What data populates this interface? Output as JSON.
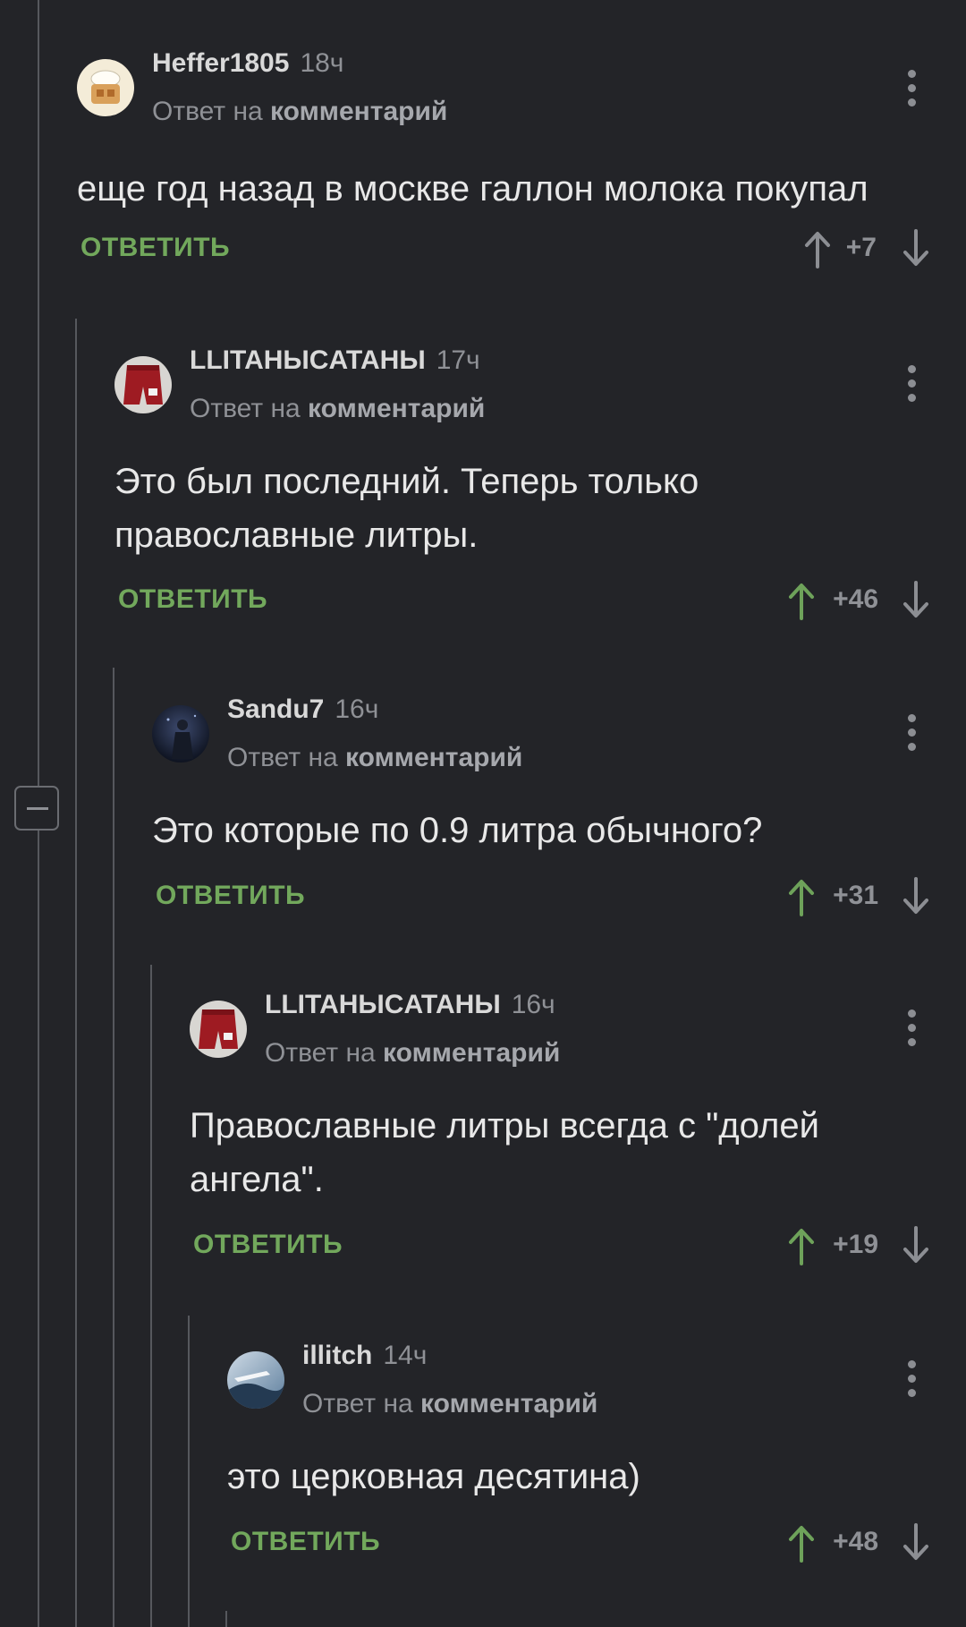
{
  "labels": {
    "reply_to_prefix": "Ответ на",
    "reply_to_target": "комментарий",
    "reply_button": "ОТВЕТИТЬ"
  },
  "colors": {
    "background": "#232428",
    "reply_button": "#72a85c",
    "upvoted_arrow": "#6ea25a",
    "neutral_arrow": "#8c8e93"
  },
  "comments": [
    {
      "username": "Heffer1805",
      "time": "18ч",
      "text": "еще год назад в москве галлон молока покупал",
      "rating": "+7",
      "upvoted": false
    },
    {
      "username": "LLITAHЫCATAHЫ",
      "time": "17ч",
      "text": "Это был последний. Теперь только православные литры.",
      "rating": "+46",
      "upvoted": true
    },
    {
      "username": "Sandu7",
      "time": "16ч",
      "text": "Это которые по 0.9 литра обычного?",
      "rating": "+31",
      "upvoted": true
    },
    {
      "username": "LLITAHЫCATAHЫ",
      "time": "16ч",
      "text": "Православные литры всегда с \"долей ангела\".",
      "rating": "+19",
      "upvoted": true
    },
    {
      "username": "illitch",
      "time": "14ч",
      "text": "это церковная десятина)",
      "rating": "+48",
      "upvoted": true
    }
  ]
}
